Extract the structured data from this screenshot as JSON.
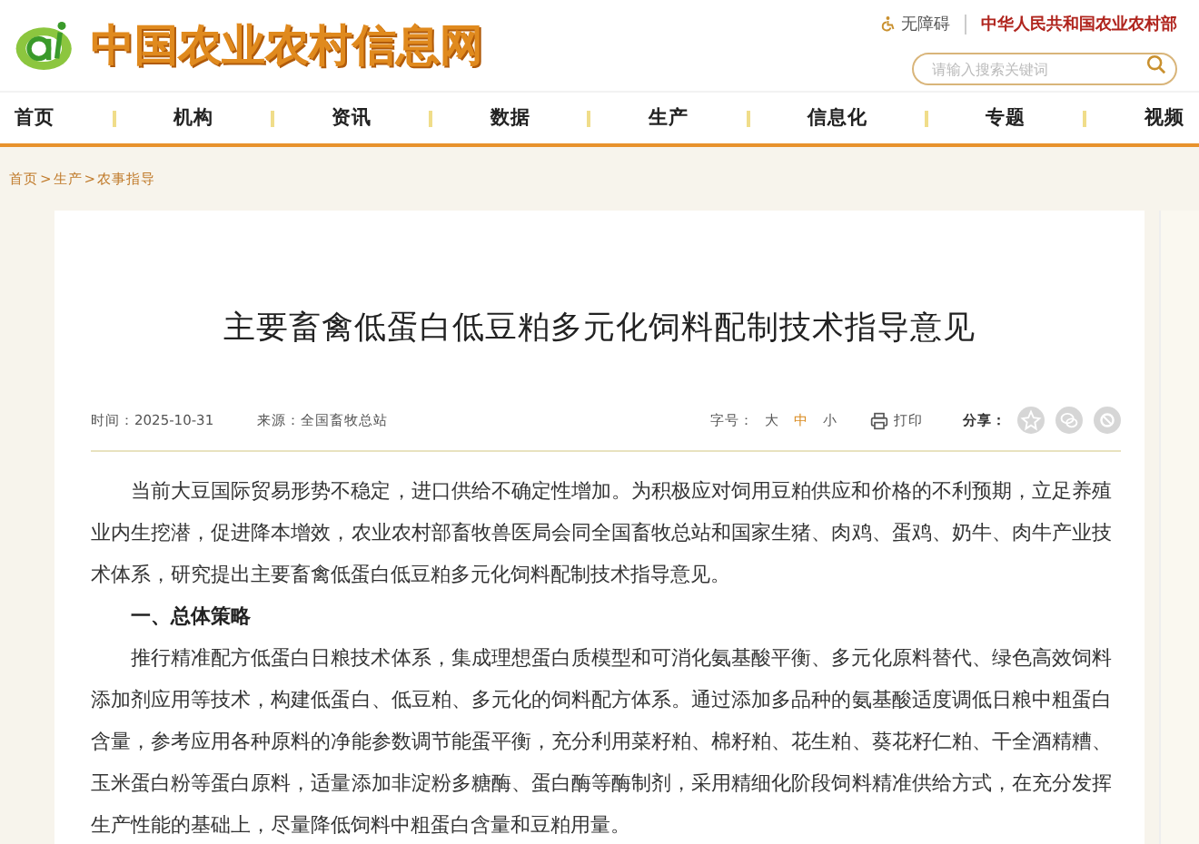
{
  "header": {
    "site_name": "中国农业农村信息网",
    "accessibility": "无障碍",
    "ministry": "中华人民共和国农业农村部",
    "search": {
      "placeholder": "请输入搜索关键词"
    }
  },
  "nav": [
    {
      "label": "首页"
    },
    {
      "label": "机构"
    },
    {
      "label": "资讯"
    },
    {
      "label": "数据"
    },
    {
      "label": "生产"
    },
    {
      "label": "信息化"
    },
    {
      "label": "专题"
    },
    {
      "label": "视频"
    }
  ],
  "breadcrumb": [
    "首页",
    ">",
    "生产",
    ">",
    "农事指导"
  ],
  "article": {
    "title": "主要畜禽低蛋白低豆粕多元化饲料配制技术指导意见",
    "date": "时间：2025-10-31",
    "source": "来源：全国畜牧总站",
    "font_size_label": "字号：",
    "font_sizes": [
      {
        "label": "大",
        "selected": false
      },
      {
        "label": "中",
        "selected": true
      },
      {
        "label": "小",
        "selected": false
      }
    ],
    "print": "打印",
    "share_label": "分享：",
    "body": [
      {
        "kind": "paragraph",
        "text": "当前大豆国际贸易形势不稳定，进口供给不确定性增加。为积极应对饲用豆粕供应和价格的不利预期，立足养殖业内生挖潜，促进降本增效，农业农村部畜牧兽医局会同全国畜牧总站和国家生猪、肉鸡、蛋鸡、奶牛、肉牛产业技术体系，研究提出主要畜禽低蛋白低豆粕多元化饲料配制技术指导意见。"
      },
      {
        "kind": "heading",
        "text": "一、总体策略"
      },
      {
        "kind": "paragraph",
        "text": "推行精准配方低蛋白日粮技术体系，集成理想蛋白质模型和可消化氨基酸平衡、多元化原料替代、绿色高效饲料添加剂应用等技术，构建低蛋白、低豆粕、多元化的饲料配方体系。通过添加多品种的氨基酸适度调低日粮中粗蛋白含量，参考应用各种原料的净能参数调节能蛋平衡，充分利用菜籽粕、棉籽粕、花生粕、葵花籽仁粕、干全酒精糟、玉米蛋白粉等蛋白原料，适量添加非淀粉多糖酶、蛋白酶等酶制剂，采用精细化阶段饲料精准供给方式，在充分发挥生产性能的基础上，尽量降低饲料中粗蛋白含量和豆粕用量。"
      }
    ]
  }
}
